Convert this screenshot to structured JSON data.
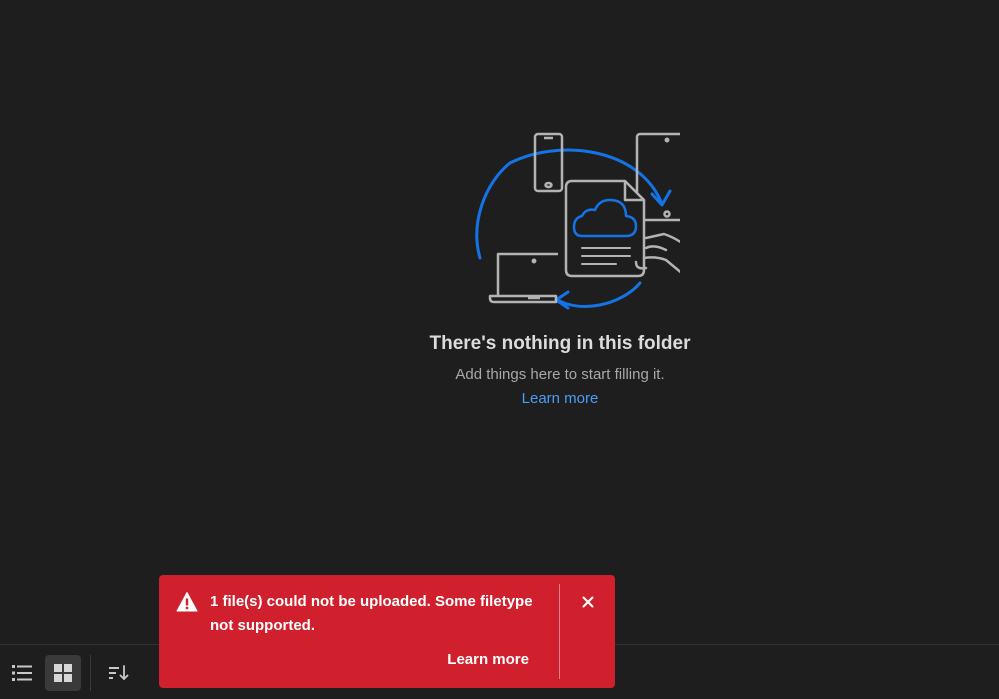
{
  "empty_state": {
    "title": "There's nothing in this folder",
    "subtitle": "Add things here to start filling it.",
    "link_label": "Learn more",
    "illustration": "devices-sync-cloud-illustration"
  },
  "toast": {
    "variant": "negative",
    "icon": "alert-triangle-icon",
    "message": "1 file(s) could not be uploaded. Some filetype not supported.",
    "action_label": "Learn more",
    "close_icon": "close-icon"
  },
  "toolbar": {
    "buttons": [
      {
        "name": "list-view",
        "icon": "list-view-icon",
        "active": false
      },
      {
        "name": "grid-view",
        "icon": "grid-view-icon",
        "active": true
      },
      {
        "name": "sort",
        "icon": "sort-icon",
        "active": false
      }
    ]
  },
  "colors": {
    "background": "#1e1e1e",
    "accent_blue": "#1473e6",
    "link_blue": "#4b9cf5",
    "error_red": "#d0202e",
    "line_gray": "#b3b3b3"
  }
}
